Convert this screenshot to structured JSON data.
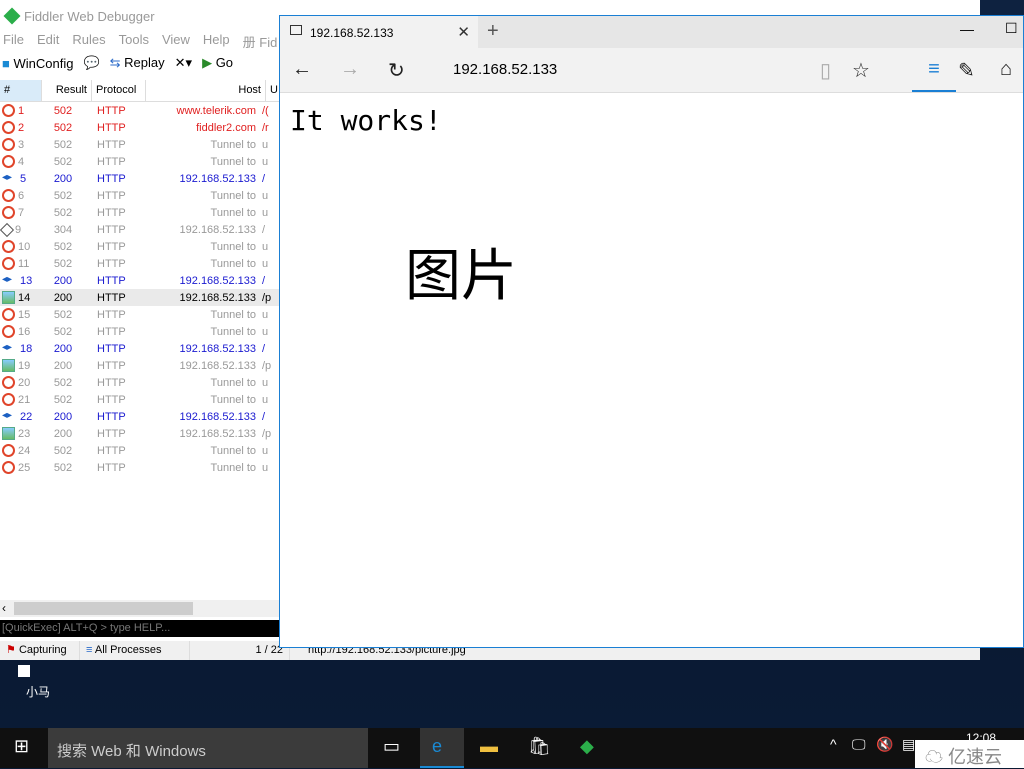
{
  "fiddler": {
    "title": "Fiddler Web Debugger",
    "menu": [
      "File",
      "Edit",
      "Rules",
      "Tools",
      "View",
      "Help",
      "册 Fid"
    ],
    "toolbar": {
      "winconfig": "WinConfig",
      "replay": "Replay",
      "go": "Go"
    },
    "columns": [
      "#",
      "Result",
      "Protocol",
      "Host",
      "U"
    ],
    "sessions": [
      {
        "id": "1",
        "result": "502",
        "protocol": "HTTP",
        "host": "www.telerik.com",
        "url": "/(",
        "type": "error",
        "color": "#e02020"
      },
      {
        "id": "2",
        "result": "502",
        "protocol": "HTTP",
        "host": "fiddler2.com",
        "url": "/r",
        "type": "error",
        "color": "#e02020"
      },
      {
        "id": "3",
        "result": "502",
        "protocol": "HTTP",
        "host": "Tunnel to",
        "url": "u",
        "type": "error",
        "color": "#999999"
      },
      {
        "id": "4",
        "result": "502",
        "protocol": "HTTP",
        "host": "Tunnel to",
        "url": "u",
        "type": "error",
        "color": "#999999"
      },
      {
        "id": "5",
        "result": "200",
        "protocol": "HTTP",
        "host": "192.168.52.133",
        "url": "/",
        "type": "html",
        "color": "#1a1ad0"
      },
      {
        "id": "6",
        "result": "502",
        "protocol": "HTTP",
        "host": "Tunnel to",
        "url": "u",
        "type": "error",
        "color": "#999999"
      },
      {
        "id": "7",
        "result": "502",
        "protocol": "HTTP",
        "host": "Tunnel to",
        "url": "u",
        "type": "error",
        "color": "#999999"
      },
      {
        "id": "9",
        "result": "304",
        "protocol": "HTTP",
        "host": "192.168.52.133",
        "url": "/",
        "type": "notmodified",
        "color": "#999999"
      },
      {
        "id": "10",
        "result": "502",
        "protocol": "HTTP",
        "host": "Tunnel to",
        "url": "u",
        "type": "error",
        "color": "#999999"
      },
      {
        "id": "11",
        "result": "502",
        "protocol": "HTTP",
        "host": "Tunnel to",
        "url": "u",
        "type": "error",
        "color": "#999999"
      },
      {
        "id": "13",
        "result": "200",
        "protocol": "HTTP",
        "host": "192.168.52.133",
        "url": "/",
        "type": "html",
        "color": "#1a1ad0"
      },
      {
        "id": "14",
        "result": "200",
        "protocol": "HTTP",
        "host": "192.168.52.133",
        "url": "/p",
        "type": "image",
        "color": "#000000",
        "selected": true
      },
      {
        "id": "15",
        "result": "502",
        "protocol": "HTTP",
        "host": "Tunnel to",
        "url": "u",
        "type": "error",
        "color": "#999999"
      },
      {
        "id": "16",
        "result": "502",
        "protocol": "HTTP",
        "host": "Tunnel to",
        "url": "u",
        "type": "error",
        "color": "#999999"
      },
      {
        "id": "18",
        "result": "200",
        "protocol": "HTTP",
        "host": "192.168.52.133",
        "url": "/",
        "type": "html",
        "color": "#1a1ad0"
      },
      {
        "id": "19",
        "result": "200",
        "protocol": "HTTP",
        "host": "192.168.52.133",
        "url": "/p",
        "type": "image",
        "color": "#999999"
      },
      {
        "id": "20",
        "result": "502",
        "protocol": "HTTP",
        "host": "Tunnel to",
        "url": "u",
        "type": "error",
        "color": "#999999"
      },
      {
        "id": "21",
        "result": "502",
        "protocol": "HTTP",
        "host": "Tunnel to",
        "url": "u",
        "type": "error",
        "color": "#999999"
      },
      {
        "id": "22",
        "result": "200",
        "protocol": "HTTP",
        "host": "192.168.52.133",
        "url": "/",
        "type": "html",
        "color": "#1a1ad0"
      },
      {
        "id": "23",
        "result": "200",
        "protocol": "HTTP",
        "host": "192.168.52.133",
        "url": "/p",
        "type": "image",
        "color": "#999999"
      },
      {
        "id": "24",
        "result": "502",
        "protocol": "HTTP",
        "host": "Tunnel to",
        "url": "u",
        "type": "error",
        "color": "#999999"
      },
      {
        "id": "25",
        "result": "502",
        "protocol": "HTTP",
        "host": "Tunnel to",
        "url": "u",
        "type": "error",
        "color": "#999999"
      }
    ],
    "quickexec": "[QuickExec] ALT+Q > type HELP...",
    "status": {
      "capturing": "Capturing",
      "processes": "All Processes",
      "count": "1 / 22",
      "url": "http://192.168.52.133/picture.jpg"
    }
  },
  "browser": {
    "tab_title": "192.168.52.133",
    "address": "192.168.52.133",
    "heading": "It works!",
    "image_alt": "图片"
  },
  "desktop": {
    "icon_label": "小马"
  },
  "taskbar": {
    "search_placeholder": "搜索 Web 和 Windows",
    "clock": "12:08"
  },
  "watermark": "亿速云"
}
